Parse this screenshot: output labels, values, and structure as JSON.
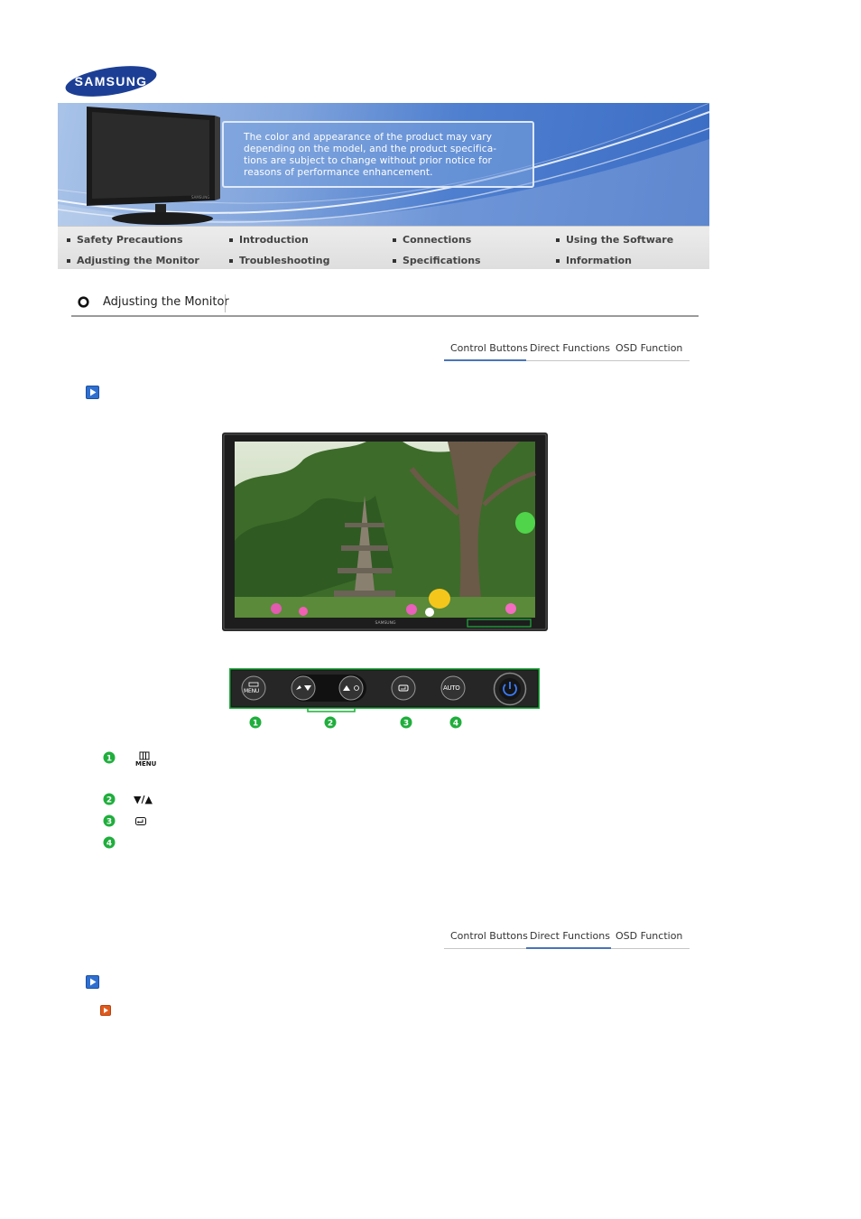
{
  "brand": {
    "logo_text": "SAMSUNG"
  },
  "banner": {
    "notice_lines": [
      "The color and appearance of the product may vary",
      "depending on the model, and the product specifica-",
      "tions are subject to change without prior notice for",
      "reasons of performance enhancement."
    ],
    "monitor_brand": "SAMSUNG"
  },
  "nav": {
    "items": [
      {
        "label": "Safety Precautions"
      },
      {
        "label": "Introduction"
      },
      {
        "label": "Connections"
      },
      {
        "label": "Using the Software"
      },
      {
        "label": "Adjusting the Monitor"
      },
      {
        "label": "Troubleshooting"
      },
      {
        "label": "Specifications"
      },
      {
        "label": "Information"
      }
    ]
  },
  "section": {
    "title": "Adjusting the Monitor"
  },
  "tabs": [
    "Control Buttons",
    "Direct Functions",
    "OSD Function"
  ],
  "control_panel": {
    "buttons": [
      "MENU",
      "AUTO"
    ],
    "callouts": [
      "1",
      "2",
      "3",
      "4"
    ]
  },
  "legend": {
    "menu_caption": "MENU",
    "arrows": "▼/▲"
  },
  "colors": {
    "accent_green": "#1fae3c",
    "tab_underline": "#4a74b8",
    "play_blue": "#2f6fd1",
    "play_orange": "#e05a1c"
  }
}
